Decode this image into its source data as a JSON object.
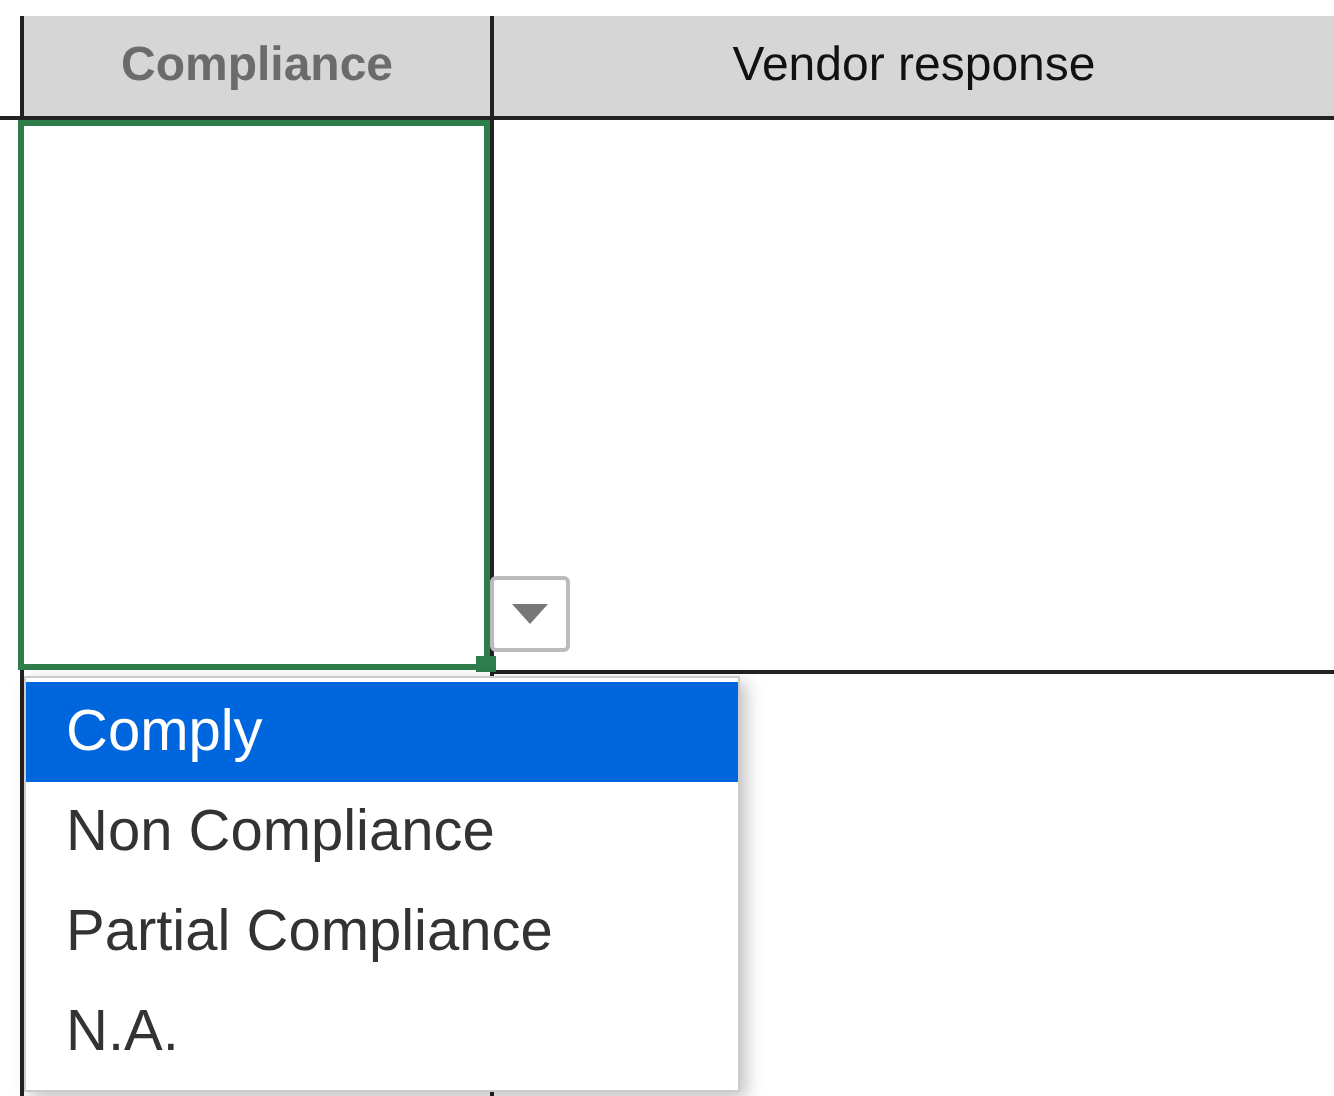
{
  "columns": [
    {
      "label": "Compliance",
      "selected": true
    },
    {
      "label": "Vendor response",
      "selected": false
    }
  ],
  "dropdown": {
    "items": [
      {
        "label": "Comply",
        "selected": true
      },
      {
        "label": "Non Compliance",
        "selected": false
      },
      {
        "label": "Partial Compliance",
        "selected": false
      },
      {
        "label": "N.A.",
        "selected": false
      }
    ]
  }
}
